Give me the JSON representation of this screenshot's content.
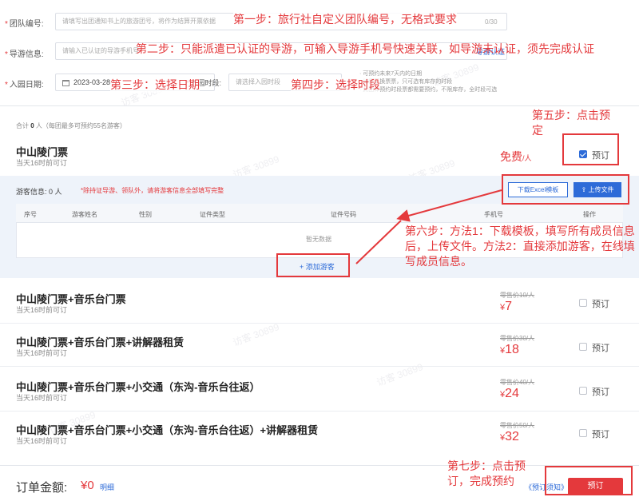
{
  "form": {
    "group_no": {
      "label": "团队编号:",
      "placeholder": "请填写出团通知书上的旅游团号，将作为结算开票依据",
      "suffix": "0/30"
    },
    "guide": {
      "label": "导游信息:",
      "placeholder": "请输入已认证的导游手机号",
      "link": "导游认证"
    },
    "date": {
      "label": "入园日期:",
      "value": "2023-03-28",
      "mid_label": "入园时段:",
      "time_placeholder": "请选择入园时段",
      "hints": [
        "· 可预约未来7天内的日期",
        "· 如需更换票票，只可选有库存的时段",
        "· 此团体预约时段票都需要预约，不限库存，全时段可选"
      ]
    }
  },
  "summary": {
    "prefix": "合计",
    "count": "0",
    "suffix": "人（每团最多可预约55名游客）"
  },
  "products": [
    {
      "name": "中山陵门票",
      "sub": "当天16时前可订",
      "price": "免费",
      "unit": "/人",
      "book": "预订",
      "checked": true
    },
    {
      "name": "中山陵门票+音乐台门票",
      "sub": "当天16时前可订",
      "strike": "零售价10/人",
      "currency": "¥",
      "price": "7",
      "book": "预订",
      "checked": false
    },
    {
      "name": "中山陵门票+音乐台门票+讲解器租赁",
      "sub": "当天16时前可订",
      "strike": "零售价30/人",
      "currency": "¥",
      "price": "18",
      "book": "预订",
      "checked": false
    },
    {
      "name": "中山陵门票+音乐台门票+小交通（东沟-音乐台往返）",
      "sub": "当天16时前可订",
      "strike": "零售价40/人",
      "currency": "¥",
      "price": "24",
      "book": "预订",
      "checked": false
    },
    {
      "name": "中山陵门票+音乐台门票+小交通（东沟-音乐台往返）+讲解器租赁",
      "sub": "当天16时前可订",
      "strike": "零售价50/人",
      "currency": "¥",
      "price": "32",
      "book": "预订",
      "checked": false
    }
  ],
  "visitors": {
    "label": "游客信息:",
    "count": "0 人",
    "warning": "*除持证导游、领队外，请将游客信息全部填写完整",
    "download_btn": "下载Excel模板",
    "upload_btn": "上传文件",
    "columns": [
      "序号",
      "游客姓名",
      "性别",
      "证件类型",
      "证件号码",
      "手机号",
      "操作"
    ],
    "empty": "暂无数据",
    "add_btn": "+ 添加游客"
  },
  "order": {
    "total_label": "订单金额:",
    "total": "¥0",
    "detail_link": "明细",
    "notice_link": "《预订须知》",
    "submit": "预订"
  },
  "annotations": {
    "step1": "第一步：旅行社自定义团队编号，无格式要求",
    "step2": "第二步：只能派遣已认证的导游，可输入导游手机号快速关联，如导游未认证，须先完成认证",
    "step3": "第三步：选择日期",
    "step4": "第四步：选择时段",
    "step5": "第五步：点击预定",
    "step6": "第六步：方法1：下载模板，填写所有成员信息后，上传文件。方法2：直接添加游客，在线填写成员信息。",
    "step7": "第七步：点击预订，完成预约"
  },
  "watermark": "访客 30899",
  "colors": {
    "accent": "#2d6bd8",
    "annotation": "#e4393c",
    "price": "#e4393c"
  }
}
